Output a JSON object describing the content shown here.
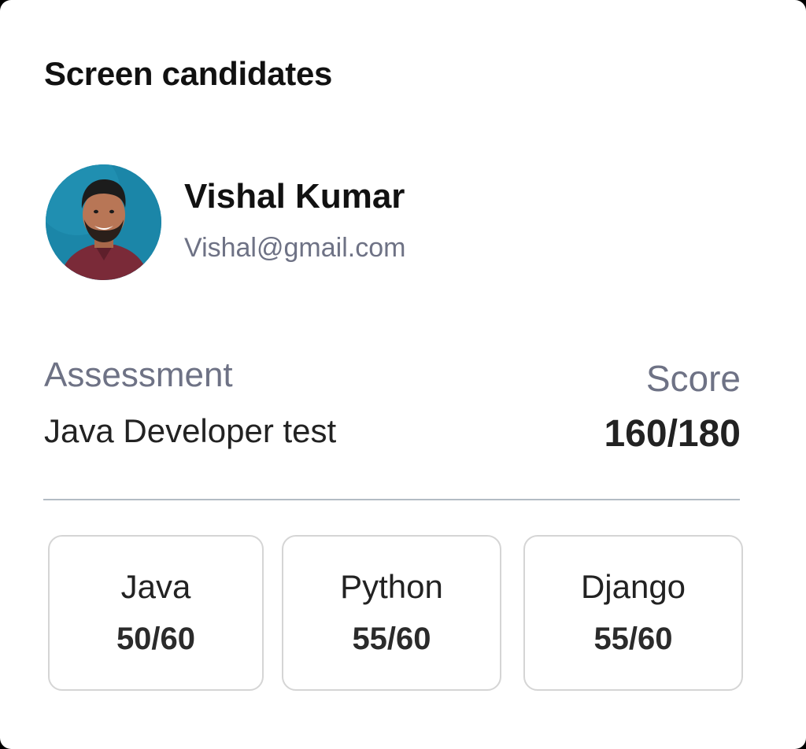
{
  "header": {
    "title": "Screen candidates"
  },
  "candidate": {
    "name": "Vishal Kumar",
    "email": "Vishal@gmail.com",
    "avatar_icon": "person-photo-avatar"
  },
  "assessment": {
    "label": "Assessment",
    "value": "Java Developer test"
  },
  "score": {
    "label": "Score",
    "value": "160/180"
  },
  "skills": [
    {
      "name": "Java",
      "score": "50/60"
    },
    {
      "name": "Python",
      "score": "55/60"
    },
    {
      "name": "Django",
      "score": "55/60"
    }
  ],
  "colors": {
    "muted_text": "#6e7285",
    "divider": "#b3bcc4",
    "card_border": "#d5d5d5",
    "avatar_bg": "#1a7fa0",
    "shirt": "#7a2a38"
  }
}
